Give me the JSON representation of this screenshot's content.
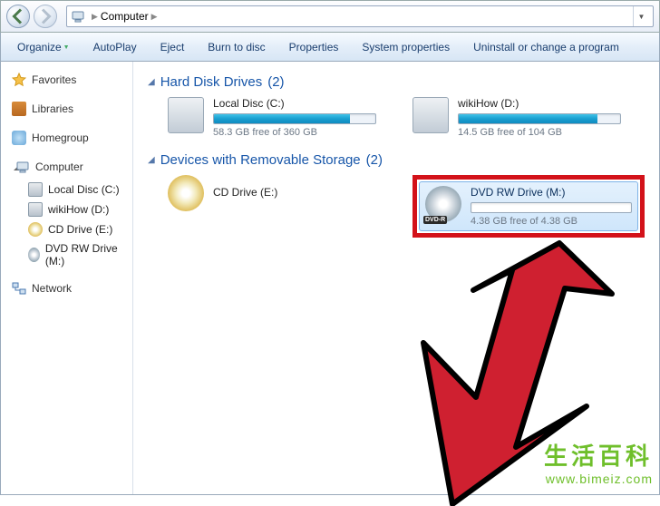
{
  "titlebar": {
    "breadcrumb_root": "Computer"
  },
  "toolbar": {
    "organize": "Organize",
    "autoplay": "AutoPlay",
    "eject": "Eject",
    "burn": "Burn to disc",
    "properties": "Properties",
    "sysprops": "System properties",
    "uninstall": "Uninstall or change a program"
  },
  "sidebar": {
    "favorites": "Favorites",
    "libraries": "Libraries",
    "homegroup": "Homegroup",
    "computer": "Computer",
    "items": [
      {
        "label": "Local Disc (C:)"
      },
      {
        "label": "wikiHow (D:)"
      },
      {
        "label": "CD Drive (E:)"
      },
      {
        "label": "DVD RW Drive (M:)"
      }
    ],
    "network": "Network"
  },
  "groups": {
    "hdd": {
      "label": "Hard Disk Drives",
      "count": "(2)"
    },
    "removable": {
      "label": "Devices with Removable Storage",
      "count": "(2)"
    }
  },
  "drives": {
    "c": {
      "name": "Local Disc (C:)",
      "free": "58.3 GB free of 360 GB",
      "pct": 84
    },
    "d": {
      "name": "wikiHow (D:)",
      "free": "14.5 GB free of 104 GB",
      "pct": 86
    },
    "e": {
      "name": "CD Drive (E:)"
    },
    "m": {
      "name": "DVD RW Drive (M:)",
      "free": "4.38 GB free of 4.38 GB",
      "pct": 0,
      "badge": "DVD-R"
    }
  },
  "watermark": {
    "cn": "生活百科",
    "url": "www.bimeiz.com"
  }
}
